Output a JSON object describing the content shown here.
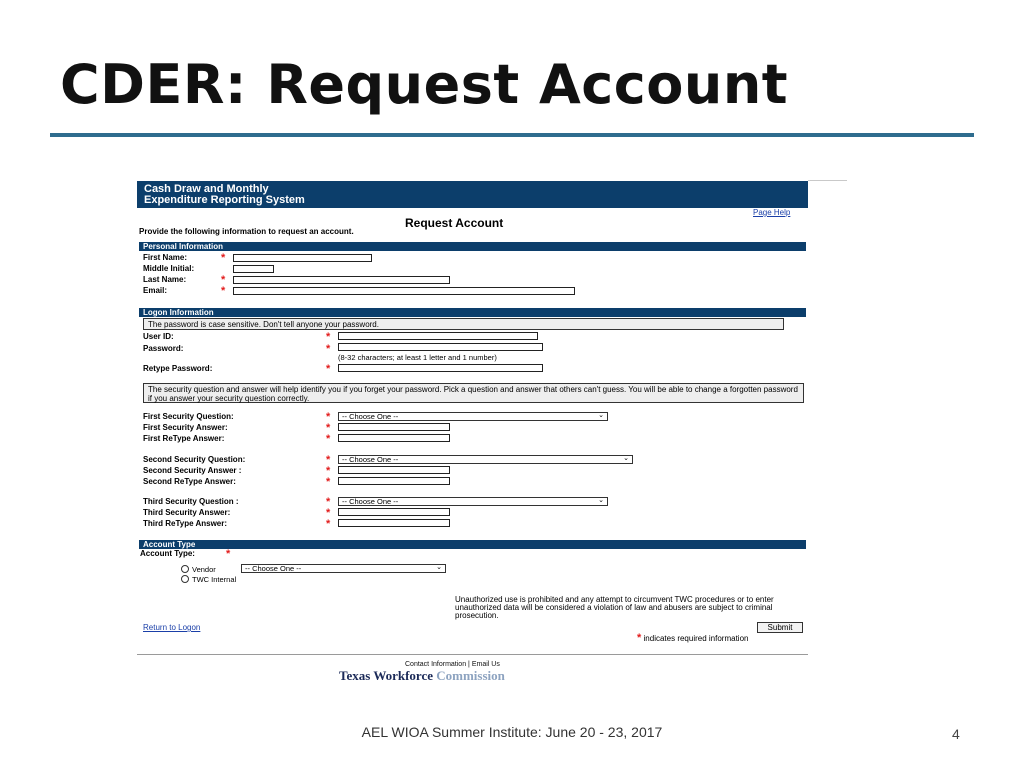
{
  "slide": {
    "title": "CDER: Request Account",
    "footer": "AEL WIOA Summer Institute: June 20 - 23, 2017",
    "page_number": "4",
    "accent_color": "#2e6c8e"
  },
  "app": {
    "banner_line1": "Cash Draw and Monthly",
    "banner_line2": "Expenditure Reporting System",
    "page_help": "Page Help",
    "form_title": "Request Account",
    "instructions": "Provide the following information to request an account.",
    "banner_color": "#0c3e6b"
  },
  "personal": {
    "header": "Personal Information",
    "first_name": "First Name:",
    "middle_initial": "Middle Initial:",
    "last_name": "Last Name:",
    "email": "Email:"
  },
  "logon": {
    "header": "Logon Information",
    "case_note": "The password is case sensitive. Don't tell anyone your password.",
    "user_id": "User ID:",
    "password": "Password:",
    "password_hint": "(8-32 characters; at least 1 letter and 1 number)",
    "retype_password": "Retype Password:",
    "security_note": "The security question and answer will help identify you if you forget your password. Pick a question and answer that others can't guess. You will be able to change a forgotten password if you answer your security question correctly.",
    "first_question": "First Security Question:",
    "first_answer": "First Security Answer:",
    "first_retype": "First ReType Answer:",
    "second_question": "Second Security Question:",
    "second_answer": "Second Security Answer :",
    "second_retype": "Second ReType Answer:",
    "third_question": "Third Security Question :",
    "third_answer": "Third Security Answer:",
    "third_retype": "Third ReType Answer:",
    "choose_one": "-- Choose One --"
  },
  "account": {
    "header": "Account Type",
    "label": "Account Type:",
    "vendor": "Vendor",
    "vendor_select": "-- Choose One --",
    "twc_internal": "TWC Internal"
  },
  "footer_area": {
    "warning": "Unauthorized use is prohibited and any attempt to circumvent TWC procedures or to enter unauthorized data will be considered a violation of law and abusers are subject to criminal prosecution.",
    "return_link": "Return to Logon",
    "submit": "Submit",
    "required_note": "indicates required information",
    "required_star": "*",
    "contact": "Contact Information",
    "separator": "|",
    "email_us": "Email Us",
    "logo_part1": "Texas Workforce",
    "logo_part2": "Commission"
  }
}
